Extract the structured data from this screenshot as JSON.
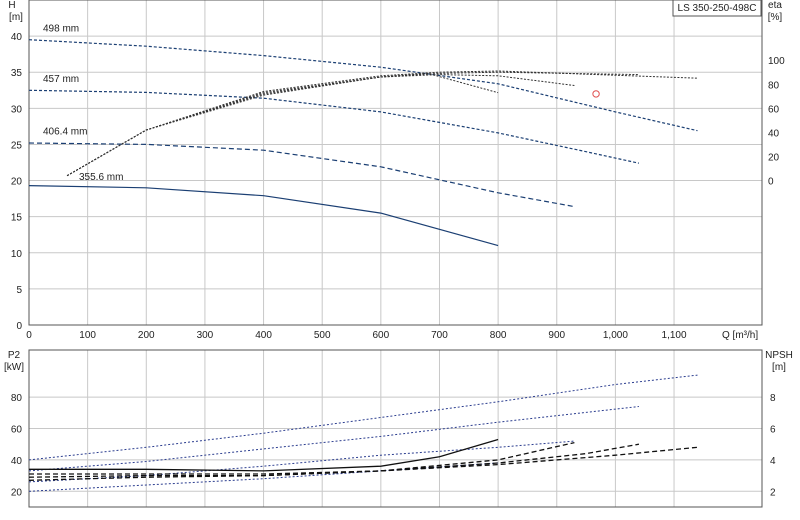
{
  "model": "LS 350-250-498C",
  "colors": {
    "head": "#1b3f73",
    "eff": "#333333",
    "power": "#2b3d8f",
    "npsh": "#111111",
    "duty": "#e05050"
  },
  "chart_data": [
    {
      "type": "line",
      "panel": "head",
      "ylabel": "H",
      "yunit": "[m]",
      "y2label": "eta",
      "y2unit": "[%]",
      "xlabel": "Q [m³/h]",
      "xlim": [
        0,
        1250
      ],
      "ylim": [
        0,
        45
      ],
      "y2lim": [
        -120,
        150
      ],
      "xticks": [
        "0",
        "100",
        "200",
        "300",
        "400",
        "500",
        "600",
        "700",
        "800",
        "900",
        "1,000",
        "1,100"
      ],
      "yticks": [
        "0",
        "5",
        "10",
        "15",
        "20",
        "25",
        "30",
        "35",
        "40"
      ],
      "y2ticks": [
        "0",
        "20",
        "40",
        "60",
        "80",
        "100"
      ],
      "series": [
        {
          "name": "498 mm",
          "style": "dotted-dashed",
          "x": [
            0,
            200,
            400,
            600,
            800,
            1000,
            1140
          ],
          "y": [
            39.5,
            38.6,
            37.3,
            35.7,
            33.4,
            29.5,
            26.9
          ]
        },
        {
          "name": "457 mm",
          "style": "dotted-dashed",
          "x": [
            0,
            200,
            400,
            600,
            800,
            950,
            1040
          ],
          "y": [
            32.5,
            32.2,
            31.4,
            29.5,
            26.6,
            24.0,
            22.4
          ]
        },
        {
          "name": "406.4 mm",
          "style": "solid-dashed",
          "x": [
            0,
            200,
            400,
            600,
            800,
            930
          ],
          "y": [
            25.2,
            25.0,
            24.2,
            21.9,
            18.3,
            16.4
          ]
        },
        {
          "name": "355.6 mm",
          "style": "solid",
          "x": [
            0,
            200,
            400,
            600,
            800
          ],
          "y": [
            19.3,
            19.0,
            17.9,
            15.5,
            11.0
          ]
        }
      ],
      "efficiency": [
        {
          "x": [
            65,
            200,
            400,
            600,
            700,
            800,
            1140
          ],
          "y": [
            4,
            42,
            74,
            87,
            90,
            91,
            85
          ]
        },
        {
          "x": [
            65,
            200,
            400,
            600,
            700,
            800,
            1040
          ],
          "y": [
            4,
            42,
            73,
            86,
            89,
            90,
            88
          ]
        },
        {
          "x": [
            65,
            200,
            400,
            600,
            700,
            800,
            930
          ],
          "y": [
            4,
            42,
            72,
            86,
            88,
            87,
            79
          ]
        },
        {
          "x": [
            65,
            200,
            400,
            600,
            680,
            800
          ],
          "y": [
            4,
            42,
            71,
            86,
            89,
            73
          ]
        }
      ],
      "duty_point": {
        "x": 967,
        "y": 32
      }
    },
    {
      "type": "line",
      "panel": "power-npsh",
      "ylabel": "P2",
      "yunit": "[kW]",
      "y2label": "NPSH",
      "y2unit": "[m]",
      "xlim": [
        0,
        1250
      ],
      "ylim": [
        10,
        110
      ],
      "y2lim": [
        1,
        11
      ],
      "yticks": [
        "20",
        "40",
        "60",
        "80"
      ],
      "y2ticks": [
        "2",
        "4",
        "6",
        "8"
      ],
      "power": [
        {
          "name": "498 mm",
          "x": [
            0,
            200,
            400,
            600,
            800,
            1000,
            1140
          ],
          "y": [
            40,
            48,
            57,
            67,
            77,
            88,
            94
          ]
        },
        {
          "name": "457 mm",
          "x": [
            0,
            200,
            400,
            600,
            800,
            1040
          ],
          "y": [
            33,
            39,
            47,
            55,
            64,
            74
          ]
        },
        {
          "name": "406.4 mm",
          "x": [
            0,
            200,
            400,
            600,
            800,
            930
          ],
          "y": [
            26,
            30,
            36,
            43,
            48,
            52
          ]
        },
        {
          "name": "355.6 mm",
          "x": [
            0,
            200,
            400,
            600,
            800
          ],
          "y": [
            20,
            24,
            28,
            33,
            38
          ]
        }
      ],
      "npsh": [
        {
          "x": [
            0,
            200,
            400,
            600,
            800,
            1000,
            1140
          ],
          "y": [
            2.7,
            2.9,
            3.0,
            3.3,
            3.7,
            4.3,
            4.8
          ]
        },
        {
          "x": [
            0,
            200,
            400,
            600,
            800,
            950,
            1040
          ],
          "y": [
            2.9,
            3.0,
            3.0,
            3.3,
            3.8,
            4.4,
            5.0
          ]
        },
        {
          "x": [
            0,
            200,
            400,
            600,
            800,
            930
          ],
          "y": [
            3.1,
            3.1,
            3.1,
            3.3,
            4.0,
            5.1
          ]
        },
        {
          "x": [
            0,
            200,
            400,
            600,
            700,
            800
          ],
          "y": [
            3.4,
            3.4,
            3.3,
            3.6,
            4.2,
            5.3
          ]
        }
      ]
    }
  ]
}
